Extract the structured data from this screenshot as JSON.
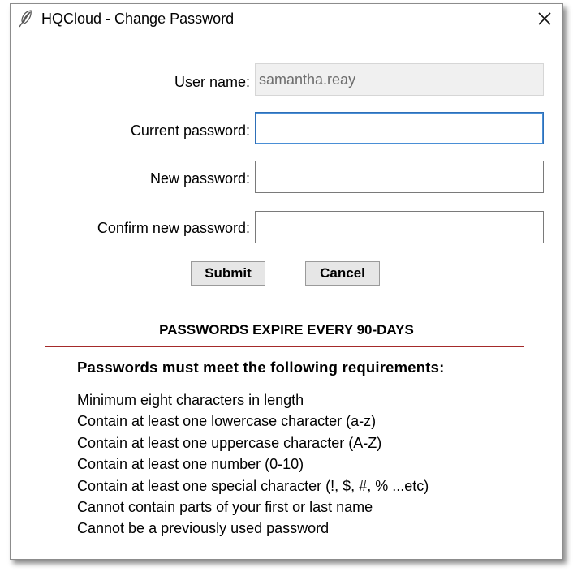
{
  "window": {
    "title": "HQCloud - Change Password"
  },
  "form": {
    "username_label": "User name:",
    "username_value": "samantha.reay",
    "current_password_label": "Current password:",
    "current_password_value": "",
    "new_password_label": "New password:",
    "new_password_value": "",
    "confirm_password_label": "Confirm new password:",
    "confirm_password_value": ""
  },
  "buttons": {
    "submit_label": "Submit",
    "cancel_label": "Cancel"
  },
  "notice": {
    "expire_text": "PASSWORDS EXPIRE EVERY 90-DAYS",
    "divider_color": "#a42a2a",
    "requirements_title": "Passwords must meet the following requirements:",
    "requirements": [
      "Minimum eight characters in length",
      "Contain at least one lowercase character (a-z)",
      "Contain at least one uppercase character (A-Z)",
      "Contain at least one number (0-10)",
      "Contain at least one special character (!, $, #, % ...etc)",
      "Cannot contain parts of your first or last name",
      "Cannot be a previously used password"
    ]
  },
  "icons": {
    "app": "feather-icon",
    "close": "close-icon"
  }
}
